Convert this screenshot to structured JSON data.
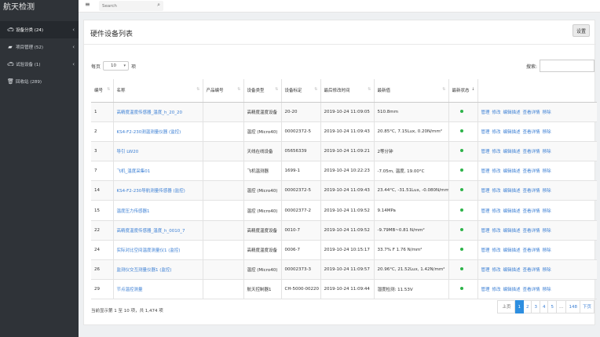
{
  "app": {
    "title": "航天检测"
  },
  "sidebar": {
    "items": [
      {
        "label": "设备分类 (24)",
        "icon": "car-icon",
        "active": true
      },
      {
        "label": "项目管理 (52)",
        "icon": "folder-icon",
        "active": false
      },
      {
        "label": "试验设备 (1)",
        "icon": "car-icon",
        "active": false
      },
      {
        "label": "回收站 (289)",
        "icon": "trash-icon",
        "active": false
      }
    ]
  },
  "topbar": {
    "search_placeholder": "Search"
  },
  "panel": {
    "title": "硬件设备列表",
    "settings_label": "设置",
    "length_prefix": "每页",
    "length_value": "10",
    "length_suffix": "项",
    "filter_label": "搜索:"
  },
  "table": {
    "columns": [
      "编号",
      "名称",
      "产品编号",
      "设备类型",
      "设备标定",
      "最后修改时间",
      "最新值",
      "最新状态",
      ""
    ],
    "rows": [
      {
        "id": "1",
        "name": "高精度温度传感器_温度_h_20_20",
        "product": "",
        "type": "高精度温度设备",
        "calib": "20-20",
        "time": "2019-10-24 11:09:05",
        "value": "510.8mm",
        "status": "ok"
      },
      {
        "id": "2",
        "name": "KS4-F2-230测温测量仪器 (监控)",
        "product": "",
        "type": "温控 (Micro40)",
        "calib": "00002372-5",
        "time": "2019-10-24 11:09:43",
        "value": "20.85°C, 7.15Lux, 0.20N/mm²",
        "status": "ok"
      },
      {
        "id": "3",
        "name": "导引 LW20",
        "product": "",
        "type": "天线在线设备",
        "calib": "05656339",
        "time": "2019-10-24 11:09:21",
        "value": "2等分钟",
        "status": "ok"
      },
      {
        "id": "7",
        "name": "飞机_温度采集01",
        "product": "",
        "type": "飞机温测器",
        "calib": "1699-1",
        "time": "2019-10-24 10:22:23",
        "value": "-7.05m, 温度, 19.00°C",
        "status": "ok"
      },
      {
        "id": "14",
        "name": "KS4-F2-230导航测量传感器 (监控)",
        "product": "",
        "type": "温控 (Micro40)",
        "calib": "00002372-5",
        "time": "2019-10-24 11:09:43",
        "value": "23.44°C, -31.51Lux, -0.080N/mm²",
        "status": "ok"
      },
      {
        "id": "15",
        "name": "温度压力传感器1",
        "product": "",
        "type": "温控 (Micro40)",
        "calib": "00002377-2",
        "time": "2019-10-24 11:09:52",
        "value": "9.14MPa",
        "status": "ok"
      },
      {
        "id": "22",
        "name": "高精度温度传感器_温度_h_0010_7",
        "product": "",
        "type": "高精度温度设备",
        "calib": "0010-7",
        "time": "2019-10-24 11:09:52",
        "value": "-9.79MB~0.81 N/mm²",
        "status": "ok"
      },
      {
        "id": "24",
        "name": "实际对比空间温度测量仪1 (监控)",
        "product": "",
        "type": "高精度温度设备",
        "calib": "0006-7",
        "time": "2019-10-24 10:15:17",
        "value": "33.7% F 1.76 N/mm²",
        "status": "ok"
      },
      {
        "id": "26",
        "name": "监测仪交互测量仪器1 (监控)",
        "product": "",
        "type": "温控 (Micro40)",
        "calib": "00002373-3",
        "time": "2019-10-24 11:09:57",
        "value": "20.96°C, 21.52Lux, 1.42N/mm²",
        "status": "ok"
      },
      {
        "id": "29",
        "name": "节点温控测量",
        "product": "",
        "type": "航天控制器1",
        "calib": "CH-5000-00220",
        "time": "2019-10-24 11:09:44",
        "value": "湿度检测: 11.53V",
        "status": "ok"
      }
    ],
    "actions": [
      "管理",
      "修改",
      "编辑描述",
      "查看详情",
      "移除"
    ]
  },
  "footer": {
    "info": "当前显示第 1 至 10 项，共 1,474 项",
    "pages": [
      "上页",
      "1",
      "2",
      "3",
      "4",
      "5",
      "…",
      "148",
      "下页"
    ],
    "active_page": "1"
  },
  "colors": {
    "sidebar_bg": "#2f3338",
    "link": "#3b7fd4",
    "status_ok": "#2db34a",
    "page_active": "#2d8ee0"
  }
}
